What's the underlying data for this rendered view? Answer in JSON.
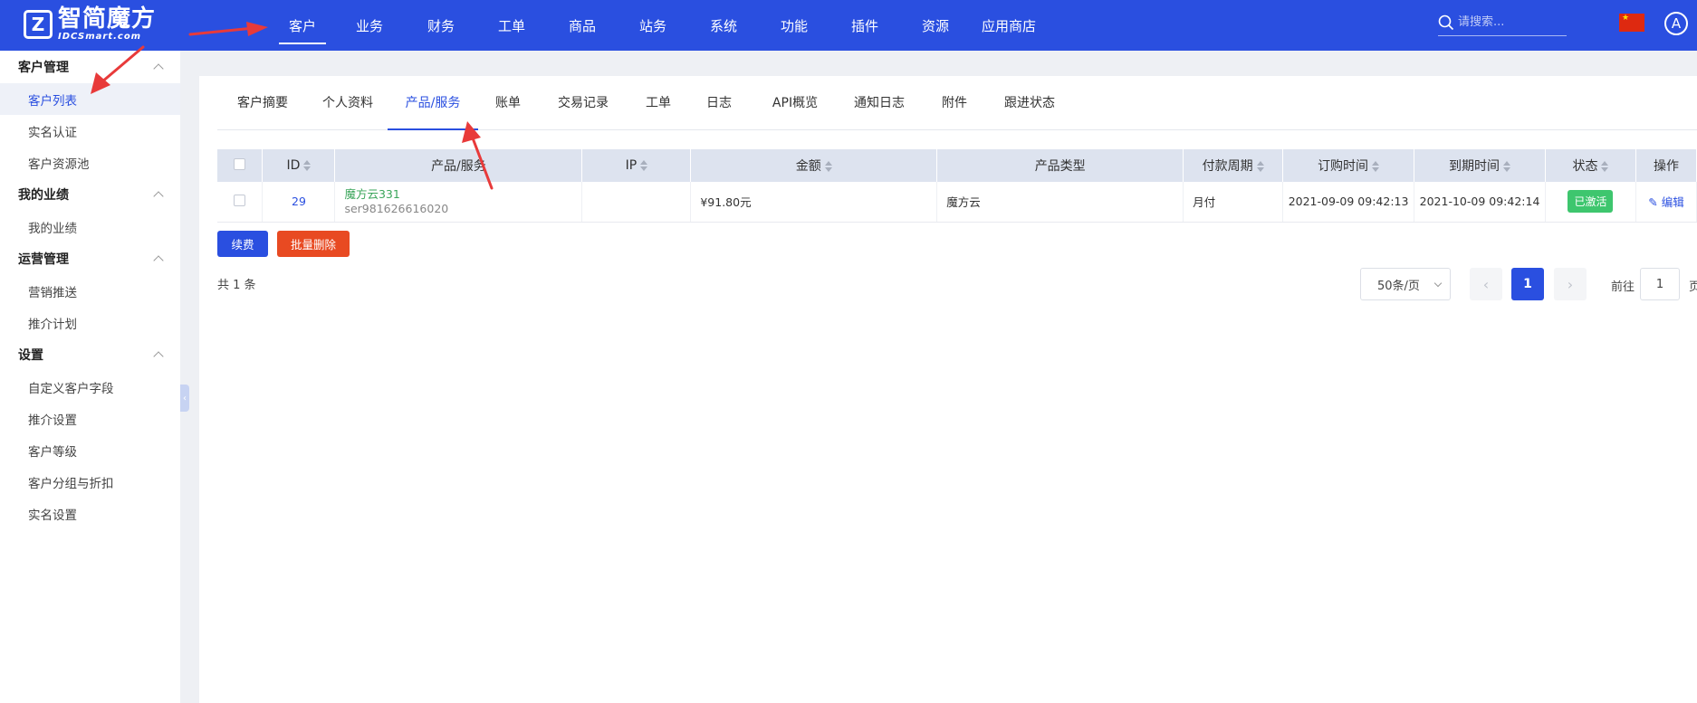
{
  "logo": {
    "title": "智简魔方",
    "subtitle": "IDCSmart.com"
  },
  "nav": [
    {
      "label": "客户",
      "active": true
    },
    {
      "label": "业务"
    },
    {
      "label": "财务"
    },
    {
      "label": "工单"
    },
    {
      "label": "商品"
    },
    {
      "label": "站务"
    },
    {
      "label": "系统"
    },
    {
      "label": "功能"
    },
    {
      "label": "插件"
    },
    {
      "label": "资源"
    },
    {
      "label": "应用商店"
    }
  ],
  "search": {
    "placeholder": "请搜索..."
  },
  "user": {
    "avatar_letter": "A"
  },
  "sidebar": {
    "groups": [
      {
        "title": "客户管理",
        "items": [
          "客户列表",
          "实名认证",
          "客户资源池"
        ]
      },
      {
        "title": "我的业绩",
        "items": [
          "我的业绩"
        ]
      },
      {
        "title": "运营管理",
        "items": [
          "营销推送",
          "推介计划"
        ]
      },
      {
        "title": "设置",
        "items": [
          "自定义客户字段",
          "推介设置",
          "客户等级",
          "客户分组与折扣",
          "实名设置"
        ]
      }
    ],
    "active_item": "客户列表"
  },
  "tabs": [
    "客户摘要",
    "个人资料",
    "产品/服务",
    "账单",
    "交易记录",
    "工单",
    "日志",
    "API概览",
    "通知日志",
    "附件",
    "跟进状态"
  ],
  "active_tab": "产品/服务",
  "table": {
    "columns": [
      "ID",
      "产品/服务",
      "IP",
      "金额",
      "产品类型",
      "付款周期",
      "订购时间",
      "到期时间",
      "状态",
      "操作"
    ],
    "rows": [
      {
        "id": "29",
        "product_name": "魔方云331",
        "product_sub": "ser981626616020",
        "ip": "",
        "amount": "¥91.80元",
        "product_type": "魔方云",
        "cycle": "月付",
        "order_time": "2021-09-09 09:42:13",
        "expire_time": "2021-10-09 09:42:14",
        "status": "已激活",
        "action": "编辑"
      }
    ]
  },
  "buttons": {
    "renew": "续费",
    "batch_delete": "批量删除"
  },
  "total": "共 1 条",
  "pager": {
    "page_size": "50条/页",
    "current": "1",
    "goto_label": "前往",
    "goto_value": "1",
    "goto_suffix": "页"
  },
  "colors": {
    "primary": "#2a4fe0",
    "danger": "#e84a22",
    "success": "#3ec66e",
    "annotation": "#e83a3a"
  }
}
